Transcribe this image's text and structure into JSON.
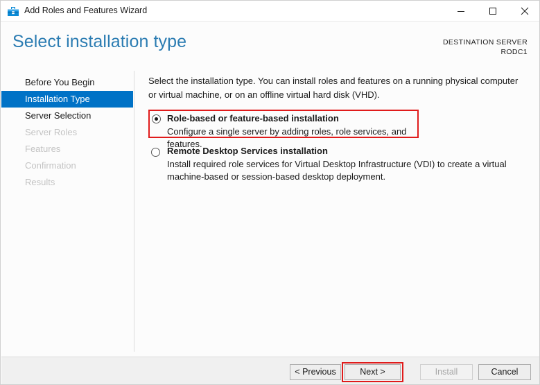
{
  "window": {
    "title": "Add Roles and Features Wizard",
    "icon": "toolbox-icon",
    "controls": {
      "minimize": "minimize-icon",
      "maximize": "maximize-icon",
      "close": "close-icon"
    }
  },
  "header": {
    "page_title": "Select installation type",
    "destination_label": "DESTINATION SERVER",
    "destination_value": "RODC1"
  },
  "sidebar": {
    "items": [
      {
        "label": "Before You Begin",
        "state": "normal"
      },
      {
        "label": "Installation Type",
        "state": "selected"
      },
      {
        "label": "Server Selection",
        "state": "normal"
      },
      {
        "label": "Server Roles",
        "state": "disabled"
      },
      {
        "label": "Features",
        "state": "disabled"
      },
      {
        "label": "Confirmation",
        "state": "disabled"
      },
      {
        "label": "Results",
        "state": "disabled"
      }
    ]
  },
  "main": {
    "intro": "Select the installation type. You can install roles and features on a running physical computer or virtual machine, or on an offline virtual hard disk (VHD).",
    "options": [
      {
        "title": "Role-based or feature-based installation",
        "description": "Configure a single server by adding roles, role services, and features.",
        "selected": true,
        "highlighted": true
      },
      {
        "title": "Remote Desktop Services installation",
        "description": "Install required role services for Virtual Desktop Infrastructure (VDI) to create a virtual machine-based or session-based desktop deployment.",
        "selected": false,
        "highlighted": false
      }
    ]
  },
  "footer": {
    "previous": "< Previous",
    "next": "Next >",
    "install": "Install",
    "cancel": "Cancel",
    "install_disabled": true,
    "next_highlighted": true
  },
  "colors": {
    "accent_blue": "#0072c6",
    "title_blue": "#2b7cb2",
    "highlight_red": "#e01b1b",
    "footer_bg": "#f0f0f0",
    "body_bg": "#fcfcfc",
    "disabled_text": "#c3c3c3"
  }
}
